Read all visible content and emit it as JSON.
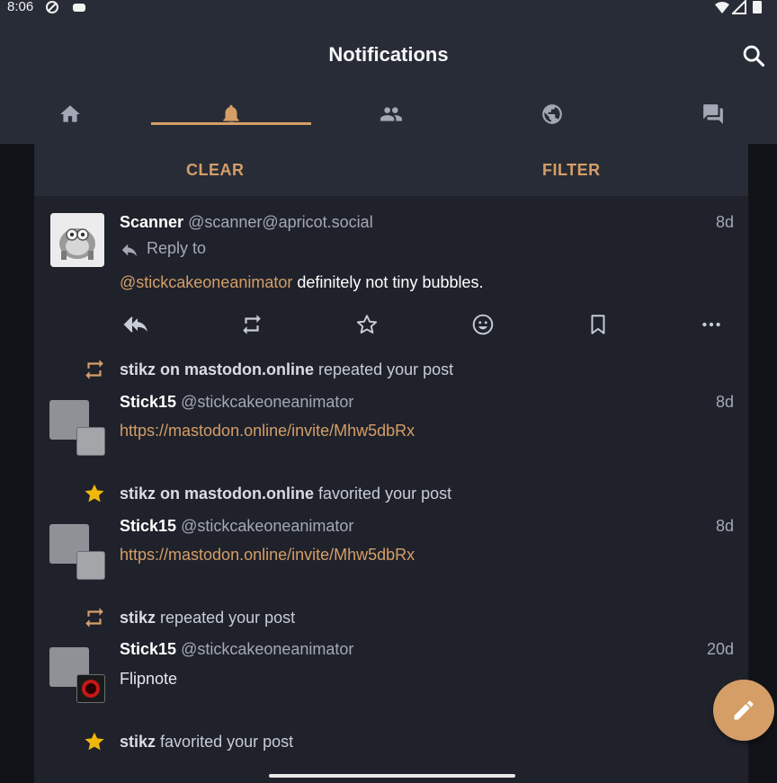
{
  "status_bar": {
    "time": "8:06"
  },
  "app_bar": {
    "title": "Notifications",
    "tabs": [
      {
        "name": "home",
        "icon": "home-icon",
        "active": false
      },
      {
        "name": "notifications",
        "icon": "bell-icon",
        "active": true
      },
      {
        "name": "local",
        "icon": "people-icon",
        "active": false
      },
      {
        "name": "federated",
        "icon": "globe-icon",
        "active": false
      },
      {
        "name": "conversations",
        "icon": "chat-icon",
        "active": false
      }
    ]
  },
  "actions": {
    "clear_label": "CLEAR",
    "filter_label": "FILTER"
  },
  "colors": {
    "accent": "#d59e67",
    "background": "#1f222b",
    "toolbar": "#282c37"
  },
  "notifications": [
    {
      "type": "mention",
      "display_name": "Scanner",
      "handle": "@scanner@apricot.social",
      "time": "8d",
      "reply_to_label": "Reply to",
      "mention": "@stickcakeoneanimator",
      "text": " definitely not tiny bubbles."
    },
    {
      "type": "reblog",
      "actor_name": "stikz on mastodon.online",
      "action_text": "repeated your post",
      "display_name": "Stick15",
      "handle": "@stickcakeoneanimator",
      "time": "8d",
      "link": "https://mastodon.online/invite/Mhw5dbRx"
    },
    {
      "type": "favourite",
      "actor_name": "stikz on mastodon.online",
      "action_text": "favorited your post",
      "display_name": "Stick15",
      "handle": "@stickcakeoneanimator",
      "time": "8d",
      "link": "https://mastodon.online/invite/Mhw5dbRx"
    },
    {
      "type": "reblog",
      "actor_name": "stikz",
      "action_text": "repeated your post",
      "display_name": "Stick15",
      "handle": "@stickcakeoneanimator",
      "time": "20d",
      "text": "Flipnote"
    },
    {
      "type": "favourite",
      "actor_name": "stikz",
      "action_text": "favorited your post"
    }
  ]
}
